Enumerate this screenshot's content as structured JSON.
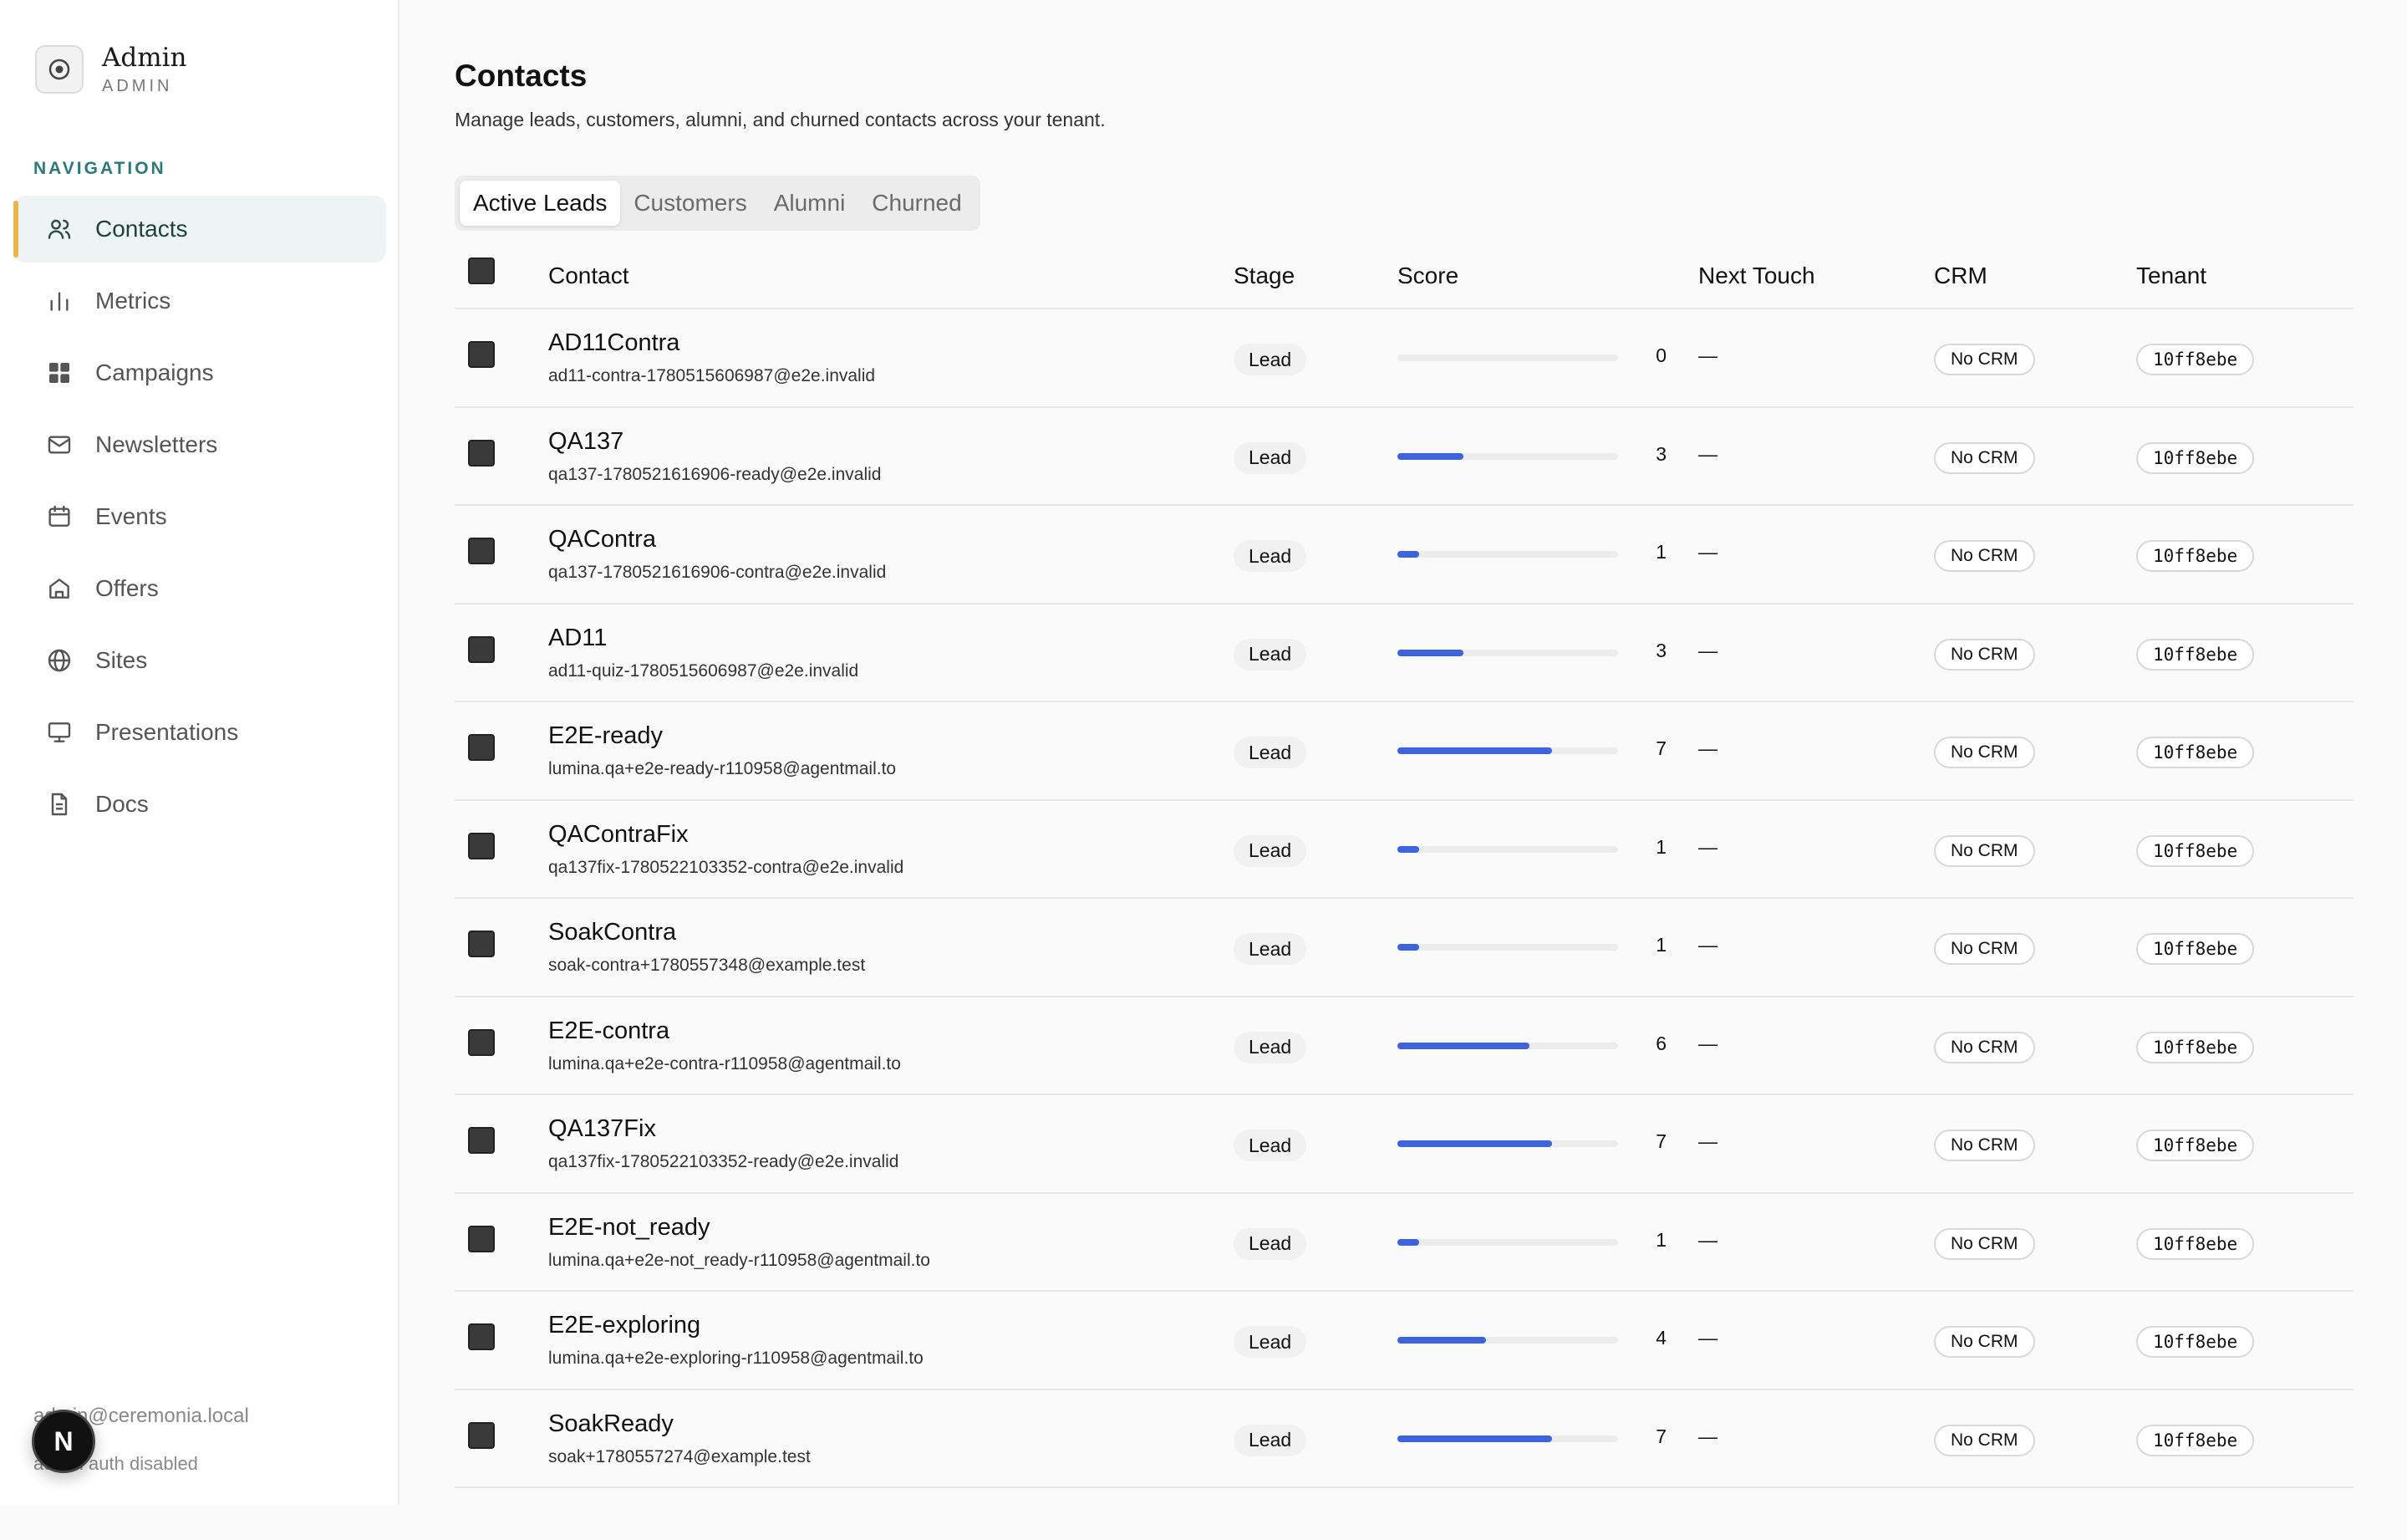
{
  "brand": {
    "name": "Admin",
    "subtitle": "ADMIN"
  },
  "sidebar": {
    "heading": "NAVIGATION",
    "items": [
      {
        "label": "Contacts",
        "icon": "users-icon",
        "active": true
      },
      {
        "label": "Metrics",
        "icon": "bar-chart-icon"
      },
      {
        "label": "Campaigns",
        "icon": "grid-icon"
      },
      {
        "label": "Newsletters",
        "icon": "mail-icon"
      },
      {
        "label": "Events",
        "icon": "calendar-icon"
      },
      {
        "label": "Offers",
        "icon": "tag-icon"
      },
      {
        "label": "Sites",
        "icon": "globe-icon"
      },
      {
        "label": "Presentations",
        "icon": "monitor-icon"
      },
      {
        "label": "Docs",
        "icon": "document-icon"
      }
    ],
    "footer": {
      "email": "admin@ceremonia.local",
      "auth": "admin auth disabled",
      "badge": "N"
    }
  },
  "page": {
    "title": "Contacts",
    "description": "Manage leads, customers, alumni, and churned contacts across your tenant."
  },
  "tabs": [
    {
      "label": "Active Leads",
      "active": true
    },
    {
      "label": "Customers"
    },
    {
      "label": "Alumni"
    },
    {
      "label": "Churned"
    }
  ],
  "table": {
    "columns": {
      "contact": "Contact",
      "stage": "Stage",
      "score": "Score",
      "next_touch": "Next Touch",
      "crm": "CRM",
      "tenant": "Tenant"
    },
    "rows": [
      {
        "name": "AD11Contra",
        "email": "ad11-contra-1780515606987@e2e.invalid",
        "stage": "Lead",
        "score": "0",
        "next": "—",
        "crm": "No CRM",
        "tenant": "10ff8ebe"
      },
      {
        "name": "QA137",
        "email": "qa137-1780521616906-ready@e2e.invalid",
        "stage": "Lead",
        "score": "3",
        "next": "—",
        "crm": "No CRM",
        "tenant": "10ff8ebe"
      },
      {
        "name": "QAContra",
        "email": "qa137-1780521616906-contra@e2e.invalid",
        "stage": "Lead",
        "score": "1",
        "next": "—",
        "crm": "No CRM",
        "tenant": "10ff8ebe"
      },
      {
        "name": "AD11",
        "email": "ad11-quiz-1780515606987@e2e.invalid",
        "stage": "Lead",
        "score": "3",
        "next": "—",
        "crm": "No CRM",
        "tenant": "10ff8ebe"
      },
      {
        "name": "E2E-ready",
        "email": "lumina.qa+e2e-ready-r110958@agentmail.to",
        "stage": "Lead",
        "score": "7",
        "next": "—",
        "crm": "No CRM",
        "tenant": "10ff8ebe"
      },
      {
        "name": "QAContraFix",
        "email": "qa137fix-1780522103352-contra@e2e.invalid",
        "stage": "Lead",
        "score": "1",
        "next": "—",
        "crm": "No CRM",
        "tenant": "10ff8ebe"
      },
      {
        "name": "SoakContra",
        "email": "soak-contra+1780557348@example.test",
        "stage": "Lead",
        "score": "1",
        "next": "—",
        "crm": "No CRM",
        "tenant": "10ff8ebe"
      },
      {
        "name": "E2E-contra",
        "email": "lumina.qa+e2e-contra-r110958@agentmail.to",
        "stage": "Lead",
        "score": "6",
        "next": "—",
        "crm": "No CRM",
        "tenant": "10ff8ebe"
      },
      {
        "name": "QA137Fix",
        "email": "qa137fix-1780522103352-ready@e2e.invalid",
        "stage": "Lead",
        "score": "7",
        "next": "—",
        "crm": "No CRM",
        "tenant": "10ff8ebe"
      },
      {
        "name": "E2E-not_ready",
        "email": "lumina.qa+e2e-not_ready-r110958@agentmail.to",
        "stage": "Lead",
        "score": "1",
        "next": "—",
        "crm": "No CRM",
        "tenant": "10ff8ebe"
      },
      {
        "name": "E2E-exploring",
        "email": "lumina.qa+e2e-exploring-r110958@agentmail.to",
        "stage": "Lead",
        "score": "4",
        "next": "—",
        "crm": "No CRM",
        "tenant": "10ff8ebe"
      },
      {
        "name": "SoakReady",
        "email": "soak+1780557274@example.test",
        "stage": "Lead",
        "score": "7",
        "next": "—",
        "crm": "No CRM",
        "tenant": "10ff8ebe"
      }
    ]
  },
  "colors": {
    "accent": "#3d63dd",
    "active_bar": "#e8b64a",
    "nav_heading": "#2b7a78"
  }
}
